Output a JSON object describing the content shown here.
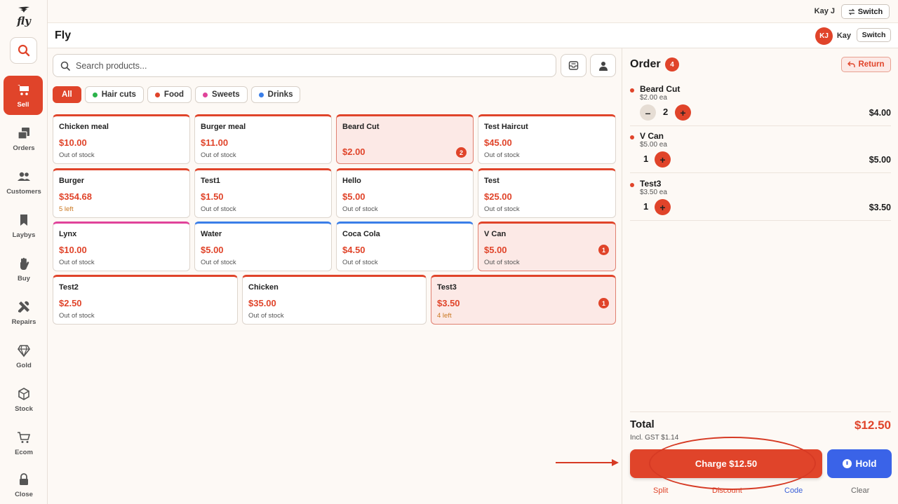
{
  "brand": {
    "logo_text": "fly",
    "store_name": "Fly"
  },
  "topbar": {
    "user_name": "Kay J",
    "switch_label": "Switch"
  },
  "header": {
    "avatar_initials": "KJ",
    "user_name": "Kay",
    "switch_label": "Switch"
  },
  "sidebar": {
    "items": [
      {
        "label": "Sell"
      },
      {
        "label": "Orders"
      },
      {
        "label": "Customers"
      },
      {
        "label": "Laybys"
      },
      {
        "label": "Buy"
      },
      {
        "label": "Repairs"
      },
      {
        "label": "Gold"
      },
      {
        "label": "Stock"
      },
      {
        "label": "Ecom"
      },
      {
        "label": "Close"
      }
    ]
  },
  "search": {
    "placeholder": "Search products..."
  },
  "filters": [
    {
      "label": "All"
    },
    {
      "label": "Hair cuts",
      "color": "#2bb34a"
    },
    {
      "label": "Food",
      "color": "#e0442a"
    },
    {
      "label": "Sweets",
      "color": "#e0439a"
    },
    {
      "label": "Drinks",
      "color": "#3a7ee8"
    }
  ],
  "products": [
    {
      "name": "Chicken meal",
      "price": "$10.00",
      "stock": "Out of stock"
    },
    {
      "name": "Burger meal",
      "price": "$11.00",
      "stock": "Out of stock"
    },
    {
      "name": "Beard Cut",
      "price": "$2.00",
      "stock": "",
      "badge": "2"
    },
    {
      "name": "Test Haircut",
      "price": "$45.00",
      "stock": "Out of stock"
    },
    {
      "name": "Burger",
      "price": "$354.68",
      "stock": "5 left"
    },
    {
      "name": "Test1",
      "price": "$1.50",
      "stock": "Out of stock"
    },
    {
      "name": "Hello",
      "price": "$5.00",
      "stock": "Out of stock"
    },
    {
      "name": "Test",
      "price": "$25.00",
      "stock": "Out of stock"
    },
    {
      "name": "Lynx",
      "price": "$10.00",
      "stock": "Out of stock"
    },
    {
      "name": "Water",
      "price": "$5.00",
      "stock": "Out of stock"
    },
    {
      "name": "Coca Cola",
      "price": "$4.50",
      "stock": "Out of stock"
    },
    {
      "name": "V Can",
      "price": "$5.00",
      "stock": "Out of stock",
      "badge": "1"
    },
    {
      "name": "Test2",
      "price": "$2.50",
      "stock": "Out of stock"
    },
    {
      "name": "Chicken",
      "price": "$35.00",
      "stock": "Out of stock"
    },
    {
      "name": "Test3",
      "price": "$3.50",
      "stock": "4 left",
      "badge": "1"
    }
  ],
  "order": {
    "title": "Order",
    "count": "4",
    "return_label": "Return",
    "items": [
      {
        "name": "Beard Cut",
        "unit_price": "$2.00 ea",
        "qty": "2",
        "total": "$4.00"
      },
      {
        "name": "V Can",
        "unit_price": "$5.00 ea",
        "qty": "1",
        "total": "$5.00"
      },
      {
        "name": "Test3",
        "unit_price": "$3.50 ea",
        "qty": "1",
        "total": "$3.50"
      }
    ],
    "total_label": "Total",
    "gst_label": "Incl. GST $1.14",
    "total_amount": "$12.50",
    "charge_label": "Charge $12.50",
    "hold_label": "Hold",
    "links": [
      "Split",
      "Discount",
      "Code",
      "Clear"
    ]
  },
  "colors": {
    "accent": "#e0442a",
    "hold": "#3a63e8",
    "link_blue": "#3a5fd8"
  }
}
